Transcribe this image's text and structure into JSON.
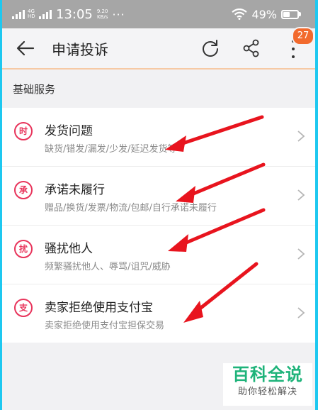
{
  "status_bar": {
    "network_label": "4G HD",
    "time": "13:05",
    "speed_value": "9.20",
    "speed_unit": "KB/s",
    "more": "···",
    "battery_percent": "49%",
    "battery_level": 0.45
  },
  "app_bar": {
    "title": "申请投诉",
    "notification_count": "27",
    "icons": [
      "arrow-left-icon",
      "refresh-icon",
      "share-icon",
      "more-vertical-icon"
    ]
  },
  "section": {
    "title": "基础服务"
  },
  "items": [
    {
      "icon_char": "时",
      "title": "发货问题",
      "subtitle": "缺货/错发/漏发/少发/延迟发货等"
    },
    {
      "icon_char": "承",
      "title": "承诺未履行",
      "subtitle": "赠品/换货/发票/物流/包邮/自行承诺未履行"
    },
    {
      "icon_char": "扰",
      "title": "骚扰他人",
      "subtitle": "频繁骚扰他人、辱骂/诅咒/威胁"
    },
    {
      "icon_char": "支",
      "title": "卖家拒绝使用支付宝",
      "subtitle": "卖家拒绝使用支付宝担保交易"
    }
  ],
  "watermark": {
    "main": "百科全说",
    "sub": "助你轻松解决"
  },
  "colors": {
    "accent": "#e8345b",
    "badge": "#f26a2e",
    "annotation_arrow": "#e8141e",
    "watermark": "#1eb37a",
    "frame": "#1ec8f0"
  }
}
